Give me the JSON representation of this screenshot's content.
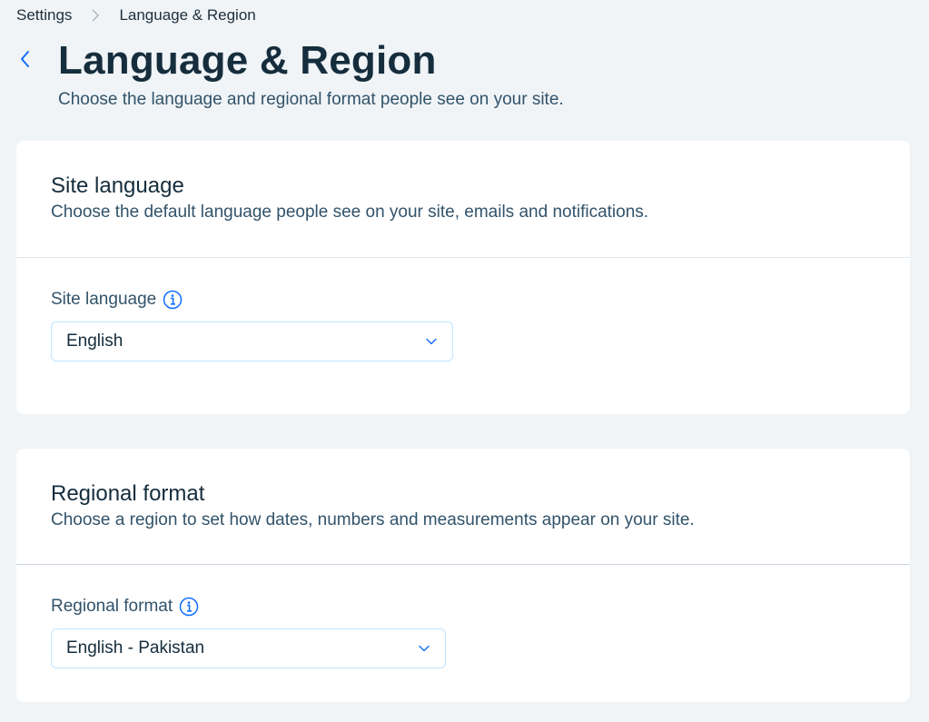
{
  "breadcrumb": {
    "parent": "Settings",
    "current": "Language & Region"
  },
  "header": {
    "title": "Language & Region",
    "subtitle": "Choose the language and regional format people see on your site."
  },
  "site_language": {
    "title": "Site language",
    "description": "Choose the default language people see on your site, emails and notifications.",
    "field_label": "Site language",
    "selected_value": "English"
  },
  "regional_format": {
    "title": "Regional format",
    "description": "Choose a region to set how dates, numbers and measurements appear on your site.",
    "field_label": "Regional format",
    "selected_value": "English - Pakistan"
  },
  "colors": {
    "accent": "#116dff",
    "background": "#f0f4f7",
    "card": "#ffffff",
    "title_text": "#162d3d",
    "secondary_text": "#32536a"
  },
  "icons": {
    "breadcrumb_separator": "chevron-right-icon",
    "back": "chevron-left-icon",
    "info": "info-icon",
    "dropdown": "chevron-down-icon"
  }
}
